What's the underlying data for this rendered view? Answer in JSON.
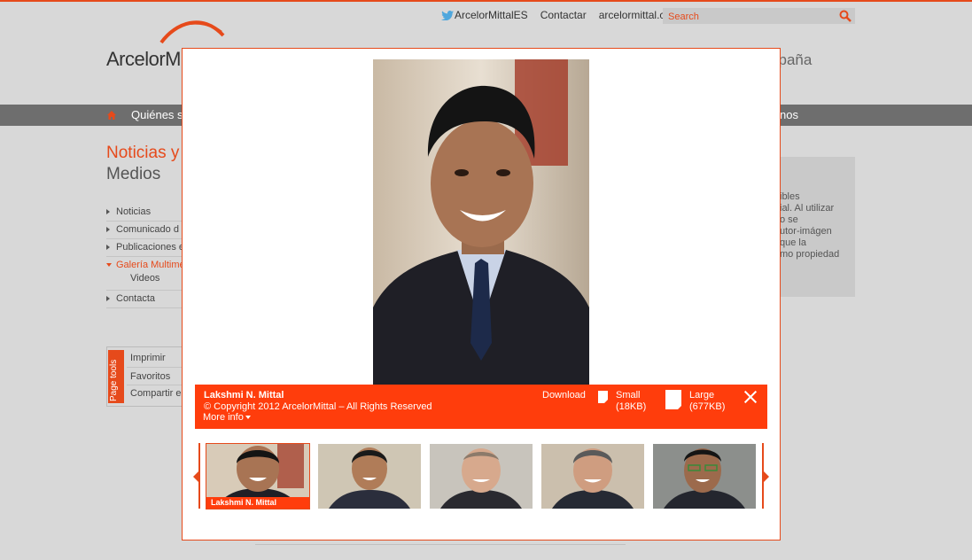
{
  "header": {
    "twitter_label": "ArcelorMittalES",
    "contact_label": "Contactar",
    "site_label": "arcelormittal.com",
    "search_placeholder": "Search",
    "logo_text": "ArcelorMittal",
    "country_text": "spaña"
  },
  "nav": {
    "item_partial_left": "Quiénes so",
    "item_partial_right": "nos"
  },
  "page": {
    "title_line1": "Noticias y",
    "title_line2": "Medios"
  },
  "sidebar": {
    "items": [
      {
        "label": "Noticias"
      },
      {
        "label": "Comunicado d"
      },
      {
        "label": "Publicaciones e"
      },
      {
        "label": "Galería Multime"
      },
      {
        "label": "Videos"
      },
      {
        "label": "Contacta"
      }
    ]
  },
  "tools": {
    "tab_label": "Page tools",
    "items": [
      "Imprimir",
      "Favoritos",
      "Compartir en"
    ]
  },
  "right_box": {
    "lines": [
      "ibles",
      "ial. Al utilizar",
      "o se",
      "utor-imágen",
      "que la",
      "mo propiedad"
    ]
  },
  "lightbox": {
    "name": "Lakshmi N. Mittal",
    "copyright": "© Copyright 2012 ArcelorMittal – All Rights Reserved",
    "more_info": "More info",
    "download_label": "Download",
    "small_label": "Small",
    "small_size": "(18KB)",
    "large_label": "Large",
    "large_size": "(677KB)",
    "thumbnails": [
      {
        "label": "Lakshmi N. Mittal",
        "selected": true
      },
      {
        "label": "",
        "selected": false
      },
      {
        "label": "",
        "selected": false
      },
      {
        "label": "",
        "selected": false
      },
      {
        "label": "",
        "selected": false
      }
    ]
  },
  "colors": {
    "brand": "#e64a1b",
    "caption_bg": "#ff3d0c",
    "nav_bg": "#6e6e6e"
  }
}
